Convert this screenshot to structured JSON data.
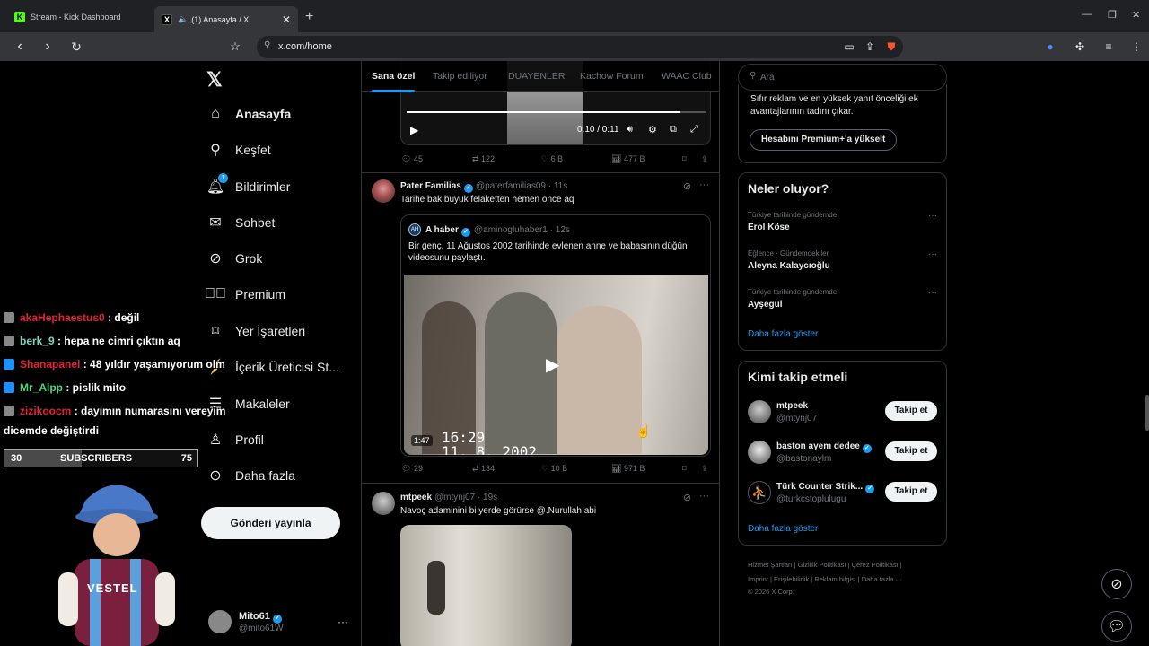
{
  "browser": {
    "tabs": [
      {
        "title": "Stream - Kick Dashboard",
        "favicon": "K"
      },
      {
        "title": "(1) Anasayfa / X",
        "favicon": "X"
      }
    ],
    "url": "x.com/home"
  },
  "nav": {
    "items": [
      {
        "label": "Anasayfa",
        "icon": "home-icon"
      },
      {
        "label": "Keşfet",
        "icon": "search-icon"
      },
      {
        "label": "Bildirimler",
        "icon": "bell-icon",
        "badge": "1"
      },
      {
        "label": "Sohbet",
        "icon": "mail-icon"
      },
      {
        "label": "Grok",
        "icon": "grok-icon"
      },
      {
        "label": "Premium",
        "icon": "premium-icon"
      },
      {
        "label": "Yer İşaretleri",
        "icon": "bookmark-icon"
      },
      {
        "label": "İçerik Üreticisi St...",
        "icon": "creator-studio-icon"
      },
      {
        "label": "Makaleler",
        "icon": "articles-icon"
      },
      {
        "label": "Profil",
        "icon": "profile-icon"
      },
      {
        "label": "Daha fazla",
        "icon": "more-circle-icon"
      }
    ],
    "post_button": "Gönderi yayınla",
    "account": {
      "name": "Mito61",
      "handle": "@mito61W"
    }
  },
  "feed": {
    "tabs": [
      "Sana özel",
      "Takip ediliyor",
      "DUAYENLER",
      "Kachow Forum",
      "WAAC Club"
    ],
    "top_video": {
      "time": "0:10 / 0:11",
      "progress": 0.91
    },
    "top_actions": {
      "replies": "45",
      "reposts": "122",
      "likes": "6 B",
      "views": "477 B"
    },
    "tweet1": {
      "name": "Pater Familias",
      "handle": "@paterfamilias09",
      "time": "· 11s",
      "text": "Tarihe bak büyük felaketten hemen önce aq",
      "quote": {
        "name": "A haber",
        "handle": "@aminogluhaber1",
        "time": "· 12s",
        "text": "Bir genç, 11 Ağustos 2002 tarihinde evlenen anne ve babasının düğün videosunu paylaştı.",
        "duration": "1:47",
        "timestamp_line1": "16:29",
        "timestamp_line2": "11. 8. 2002"
      },
      "actions": {
        "replies": "29",
        "reposts": "134",
        "likes": "10 B",
        "views": "971 B"
      }
    },
    "tweet2": {
      "name": "mtpeek",
      "handle": "@mtynj07",
      "time": "· 19s",
      "text": "Navoç adaminini bi yerde görürse @.Nurullah abi"
    }
  },
  "right": {
    "search_placeholder": "Ara",
    "premium": {
      "text": "Sıfır reklam ve en yüksek yanıt önceliği ek avantajlarının tadını çıkar.",
      "button": "Hesabını Premium+'a yükselt"
    },
    "trends": {
      "title": "Neler oluyor?",
      "items": [
        {
          "category": "Türkiye tarihinde gündemde",
          "name": "Erol Köse"
        },
        {
          "category": "Eğlence · Gündemdekiler",
          "name": "Aleyna Kalaycıoğlu"
        },
        {
          "category": "Türkiye tarihinde gündemde",
          "name": "Ayşegül"
        }
      ],
      "show_more": "Daha fazla göster"
    },
    "who_to_follow": {
      "title": "Kimi takip etmeli",
      "items": [
        {
          "name": "mtpeek",
          "handle": "@mtynj07",
          "verified": false
        },
        {
          "name": "baston ayem dedee",
          "handle": "@bastonaylm",
          "verified": true
        },
        {
          "name": "Türk Counter Strik...",
          "handle": "@turkcstoplulugu",
          "verified": true
        }
      ],
      "button": "Takip et",
      "show_more": "Daha fazla göster"
    },
    "footer": {
      "line1": "Hizmet Şartları  |  Gizlilik Politikası  |  Çerez Politikası  |",
      "line2": "Imprint  |  Erişilebilirlik  |  Reklam bilgisi  |  Daha fazla ···",
      "line3": "© 2026 X Corp."
    }
  },
  "stream": {
    "chat": [
      {
        "user": "akaHephaestus0",
        "message": ": değil",
        "color": "#e0223a"
      },
      {
        "user": "berk_9",
        "message": ": hepa ne cimri çıktın aq",
        "color": "#7ad3c0"
      },
      {
        "user": "Shanapanel",
        "message": ": 48 yıldır yaşamıyorum olm",
        "color": "#e0223a"
      },
      {
        "user": "Mr_Alpp",
        "message": ": pislik mito",
        "color": "#4fd27a"
      },
      {
        "user": "zizikoocm",
        "message": ": dayımın numarasını vereyim",
        "color": "#e0223a"
      }
    ],
    "chat_wrap": "dicemde değiştirdi",
    "subs": {
      "current": "30",
      "label": "SUBSCRIBERS",
      "goal": "75",
      "fraction": 0.4
    },
    "webcam_text": "VESTEL"
  }
}
